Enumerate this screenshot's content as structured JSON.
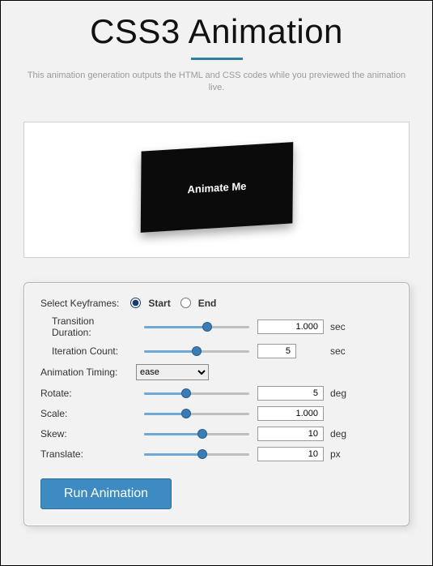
{
  "header": {
    "title": "CSS3 Animation",
    "subtitle": "This animation generation outputs the HTML and CSS codes while you previewed the animation live."
  },
  "preview": {
    "card_label": "Animate Me"
  },
  "panel": {
    "keyframes": {
      "label": "Select Keyframes:",
      "start": "Start",
      "end": "End",
      "selected": "start"
    },
    "duration": {
      "label": "Transition Duration:",
      "value": "1.000",
      "unit": "sec",
      "pct": 60
    },
    "iteration": {
      "label": "Iteration Count:",
      "value": "5",
      "unit": "sec",
      "pct": 50
    },
    "timing": {
      "label": "Animation Timing:",
      "value": "ease"
    },
    "rotate": {
      "label": "Rotate:",
      "value": "5",
      "unit": "deg",
      "pct": 40
    },
    "scale": {
      "label": "Scale:",
      "value": "1.000",
      "unit": "",
      "pct": 40
    },
    "skew": {
      "label": "Skew:",
      "value": "10",
      "unit": "deg",
      "pct": 55
    },
    "translate": {
      "label": "Translate:",
      "value": "10",
      "unit": "px",
      "pct": 55
    },
    "run_label": "Run Animation"
  }
}
